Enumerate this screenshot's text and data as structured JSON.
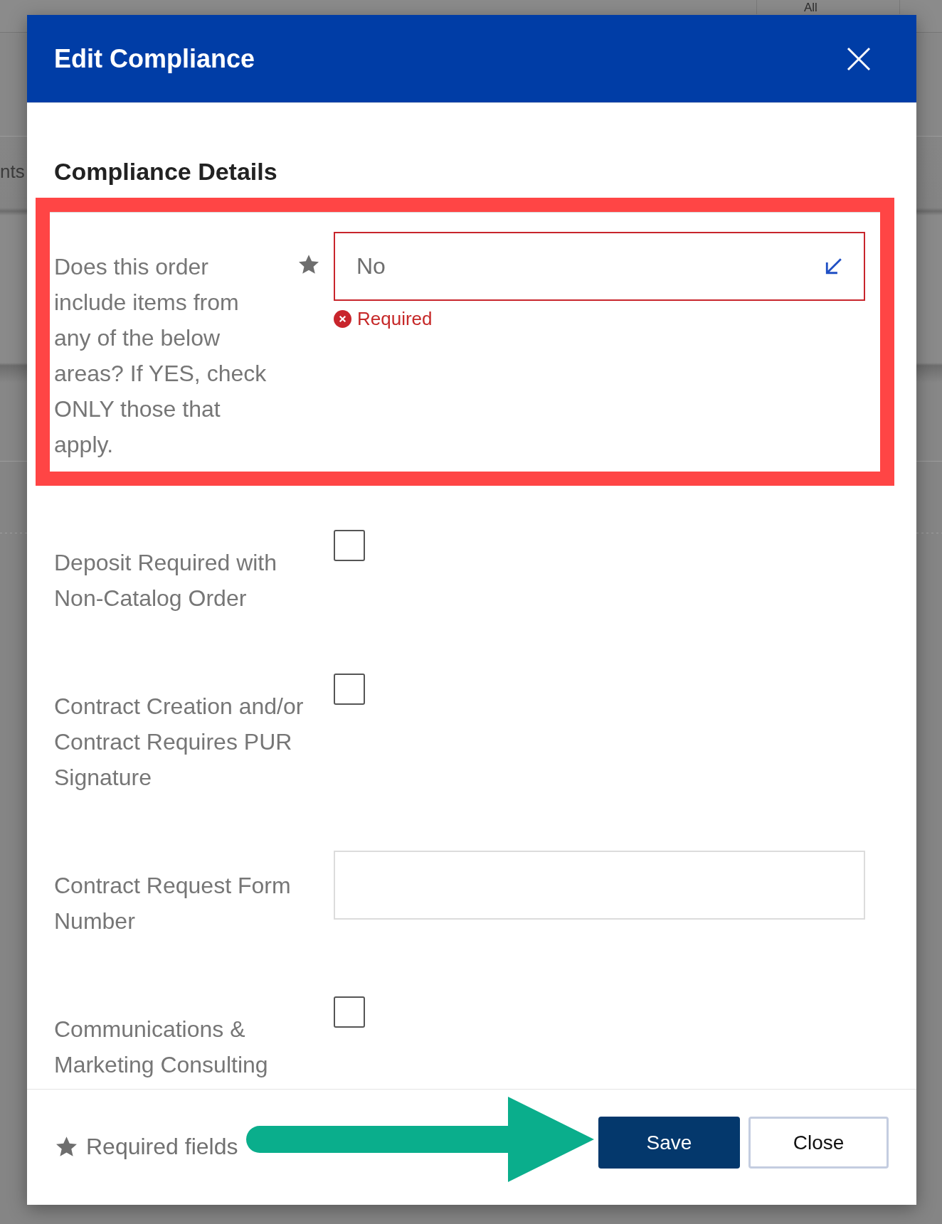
{
  "background_page": {
    "tab_label": "All",
    "side_text": "nts"
  },
  "dialog": {
    "title": "Edit Compliance"
  },
  "section": {
    "title": "Compliance Details"
  },
  "fields": [
    {
      "kind": "select",
      "label": "Does this order include items from any of the below areas? If YES, check ONLY those that apply.",
      "required": true,
      "value": "No",
      "error": "Required",
      "highlighted": true
    },
    {
      "kind": "checkbox",
      "label": "Deposit Required with Non-Catalog Order",
      "required": false,
      "checked": false,
      "highlighted": false
    },
    {
      "kind": "checkbox",
      "label": "Contract Creation and/or Contract Requires PUR Signature",
      "required": false,
      "checked": false,
      "highlighted": false
    },
    {
      "kind": "text",
      "label": "Contract Request Form Number",
      "required": false,
      "highlighted": false
    },
    {
      "kind": "checkbox",
      "label": "Communications & Marketing Consulting",
      "required": false,
      "checked": false,
      "highlighted": false
    }
  ],
  "footer": {
    "required_note": "Required fields",
    "buttons": [
      {
        "label": "Save",
        "kind": "primary",
        "pointed_at": true
      },
      {
        "label": "Close",
        "kind": "secondary",
        "pointed_at": false
      }
    ]
  }
}
